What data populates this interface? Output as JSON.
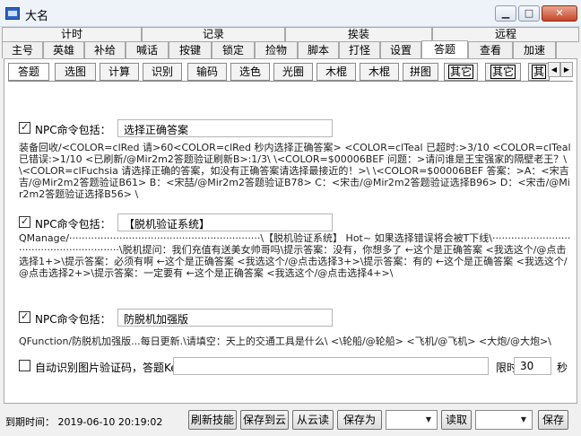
{
  "window": {
    "title": "大名"
  },
  "group_tabs": [
    "计时",
    "记录",
    "挨装",
    "远程"
  ],
  "main_tabs": [
    "主号",
    "英雄",
    "补给",
    "喊话",
    "按键",
    "锁定",
    "捡物",
    "脚本",
    "打怪",
    "设置",
    "答题",
    "查看",
    "加速"
  ],
  "main_active": "答题",
  "sub_tabs": [
    "答题",
    "选图",
    "计算",
    "识别",
    "输码",
    "选色",
    "光圈",
    "木棍",
    "木棍",
    "拼图",
    "其它",
    "其它",
    "其"
  ],
  "sub_active": "答题",
  "npc1": {
    "label": "NPC命令包括：",
    "value": "选择正确答案",
    "checked": true,
    "text": "装备回收/<COLOR=clRed 请>60<COLOR=clRed 秒内选择正确答案> <COLOR=clTeal 已超时:>3/10 <COLOR=clTeal 已错误:>1/10 <已刷新/@Mir2m2答题验证刷新B>:1/3\\ \\<COLOR=$00006BEF 问题：>请问谁是王宝强家的隔壁老王？\\ \\<COLOR=clFuchsia 请选择正确的答案，如没有正确答案请选择最接近的！>\\ \\<COLOR=$00006BEF 答案：>A：<宋吉吉/@Mir2m2答题验证B61>   B：<宋喆/@Mir2m2答题验证B78>   C：<宋击/@Mir2m2答题验证选择B96>   D：<宋击/@Mir2m2答题验证选择B56>   \\"
  },
  "npc2": {
    "label": "NPC命令包括：",
    "value": "【脱机验证系统】",
    "checked": true,
    "text": "QManage/·····························································\\【脱机验证系统】 Hot~ 如果选择错误将会被T下线\\·························································\\脱机提问：我们充值有送美女帅哥吗\\提示答案：没有，你想多了   ←这个是正确答案   <我选这个/@点击选择1+>\\提示答案：必须有啊   ←这个是正确答案   <我选这个/@点击选择3+>\\提示答案：有的   ←这个是正确答案   <我选这个/@点击选择2+>\\提示答案：一定要有   ←这个是正确答案   <我选这个/@点击选择4+>\\"
  },
  "npc3": {
    "label": "NPC命令包括：",
    "value": "防脱机加强版",
    "checked": true,
    "text": "QFunction/防脱机加强版...每日更新.\\请填空：天上的交通工具是什么\\  <\\轮船/@轮船>   <飞机/@飞机>   <大炮/@大炮>\\"
  },
  "auto_captcha": {
    "label": "自动识别图片验证码，答题Key",
    "checked": false,
    "key_value": "",
    "time_label": "限时",
    "time_value": "30",
    "sec_label": "秒"
  },
  "status": {
    "expire_label": "到期时间：",
    "expire_value": "2019-06-10 20:19:02",
    "refresh": "刷新技能",
    "save_cloud": "保存到云",
    "from_cloud": "从云读",
    "save_as": "保存为",
    "read": "读取",
    "save": "保存"
  }
}
